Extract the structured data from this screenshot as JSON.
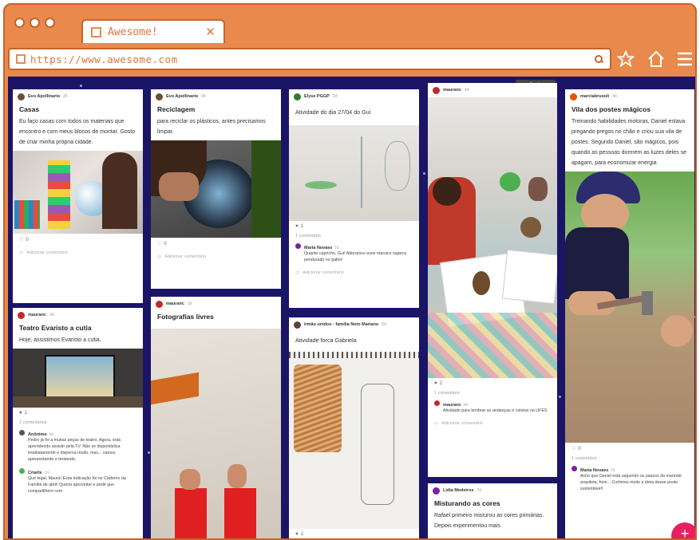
{
  "browser": {
    "tab_title": "Awesome!",
    "tab_close": "✕",
    "url": "https://www.awesome.com",
    "icons": [
      "page-icon",
      "search-icon",
      "star-icon",
      "home-icon",
      "menu-icon"
    ]
  },
  "board": {
    "columns": [
      {
        "posts": [
          {
            "author": "Evo Apollinario",
            "time": "2h",
            "avatar_color": "#6b4f3a",
            "title": "Casas",
            "body": "Eu faço casas com todos os materiais que encontro e com meus blocos de montar.  Gosto de criar minha própria cidade.",
            "likes": "0",
            "add_comment": "Adicionar comentário"
          },
          {
            "author": "mauranc",
            "time": "3d",
            "avatar_color": "#c62828",
            "title": "Teatro Evaristo a cutia",
            "body": "Hoje, assistimos Evaristo a cutia.",
            "likes": "1",
            "comments_count": "2 comentários",
            "comments": [
              {
                "author": "Anônimo",
                "time": "4d",
                "text": "Pedro já foi a muitas peças de teatro. Agora, está aprendendo assistir pela TV. Não se disponibiliza imediatamente e dispersa muito, mas... vamos apresentando e tentando.",
                "color": "#555"
              },
              {
                "author": "Criarte",
                "time": "1m",
                "text": "Que legal, Maura! Essa indicação foi no Caderno da Família de abril! Queria aproveitar e pedir que compartilhem com",
                "color": "#4caf50"
              }
            ]
          }
        ]
      },
      {
        "posts": [
          {
            "author": "Evo Apollinario",
            "time": "3h",
            "avatar_color": "#6b4f3a",
            "title": "Reciclagem",
            "body": "para reciclar os plásticos, antes precisamos limpar.",
            "likes": "0",
            "add_comment": "Adicionar comentário"
          },
          {
            "author": "mauranc",
            "time": "1d",
            "avatar_color": "#c62828",
            "title": "Fotografias livres"
          }
        ]
      },
      {
        "posts": [
          {
            "author": "Elyse PGGP",
            "time": "2d",
            "avatar_color": "#2e7d32",
            "title": "Atividade do dia 27/04 do Gui",
            "likes": "1",
            "comments_count": "1 comentário",
            "comments": [
              {
                "author": "Maria Novaes",
                "time": "1d",
                "text": "Quanto capricho, Gui! Adoramos esse macaco sapeca pendurado no galho!",
                "color": "#7b1fa2"
              }
            ],
            "add_comment": "Adicionar comentário"
          },
          {
            "author": "irmão unidos - familia Neto Mariano",
            "time": "5d",
            "avatar_color": "#5d4037",
            "title": "Atividade forca Gabriela",
            "likes": "1"
          }
        ]
      },
      {
        "posts": [
          {
            "author": "mauranc",
            "time": "4d",
            "avatar_color": "#c62828",
            "likes": "2",
            "comments_count": "1 comentário",
            "comments": [
              {
                "author": "mauranc",
                "time": "4d",
                "text": "Atividade para lembrar as andanças e coletas na UFES",
                "color": "#c62828"
              }
            ],
            "add_comment": "Adicionar comentário"
          },
          {
            "author": "Lidia Medeiros",
            "time": "7d",
            "avatar_color": "#7b1fa2",
            "title": "Misturando as cores",
            "body": "Rafael primeiro misturou as cores primárias. Depois experimentou mais"
          }
        ]
      },
      {
        "posts": [
          {
            "author": "marciabrusoli",
            "time": "4d",
            "avatar_color": "#e65100",
            "title": "Vila dos postes mágicos",
            "body": "Treinando habilidades motoras, Daniel estava pregando pregos no chão e criou sua vila de postes. Segundo Daniel, são mágicos,  pois quando as pessoas dormem as luzes deles se apagam, para economizar energia",
            "likes": "0",
            "comments_count": "1 comentário",
            "comments": [
              {
                "author": "Maria Novaes",
                "time": "1d",
                "text": "Acho que Daniel está seguindo os passos da marmde arquiteta, hein... Curtimos muito a ideia desse poste sustentável!",
                "color": "#7b1fa2"
              }
            ]
          }
        ]
      }
    ],
    "fab_label": "+",
    "tools": "✎ ⋮"
  }
}
